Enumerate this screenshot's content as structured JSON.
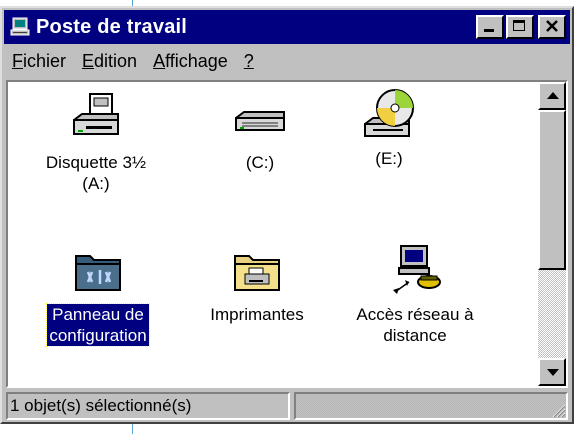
{
  "window": {
    "title": "Poste de travail",
    "title_icon": "computer-icon"
  },
  "menu": [
    {
      "accel": "F",
      "rest": "ichier"
    },
    {
      "accel": "E",
      "rest": "dition"
    },
    {
      "accel": "A",
      "rest": "ffichage"
    },
    {
      "accel": "?",
      "rest": ""
    }
  ],
  "items": [
    {
      "label_line1": "Disquette 3½",
      "label_line2": "(A:)",
      "icon": "floppy-drive-icon",
      "selected": false
    },
    {
      "label_line1": "(C:)",
      "label_line2": "",
      "icon": "hard-drive-icon",
      "selected": false
    },
    {
      "label_line1": "(E:)",
      "label_line2": "",
      "icon": "cdrom-drive-icon",
      "selected": false
    },
    {
      "label_line1": "Panneau de",
      "label_line2": "configuration",
      "icon": "control-panel-folder-icon",
      "selected": true
    },
    {
      "label_line1": "Imprimantes",
      "label_line2": "",
      "icon": "printers-folder-icon",
      "selected": false
    },
    {
      "label_line1": "Accès réseau à",
      "label_line2": "distance",
      "icon": "dial-up-networking-icon",
      "selected": false
    }
  ],
  "status": {
    "text": "1 objet(s) sélectionné(s)"
  },
  "colors": {
    "titlebar": "#000080",
    "face": "#c0c0c0",
    "selection": "#000080"
  }
}
